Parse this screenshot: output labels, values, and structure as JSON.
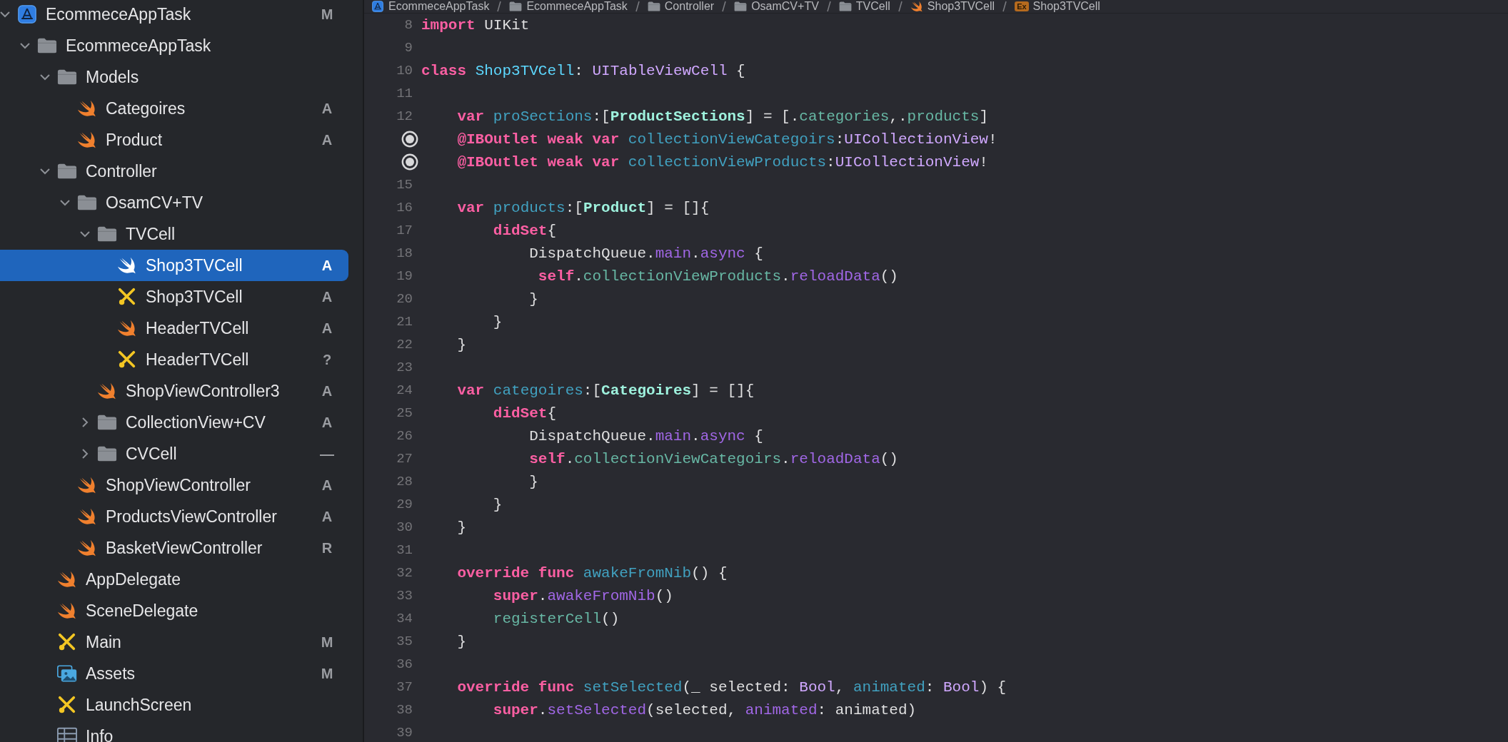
{
  "navigator": {
    "items": [
      {
        "label": "EcommeceAppTask",
        "kind": "project",
        "status": "M",
        "selected": false,
        "expanded": true,
        "children": [
          {
            "label": "EcommeceAppTask",
            "kind": "folder",
            "selected": false,
            "expanded": true,
            "children": [
              {
                "label": "Models",
                "kind": "folder",
                "selected": false,
                "expanded": true,
                "children": [
                  {
                    "label": "Categoires",
                    "kind": "swift",
                    "status": "A",
                    "selected": false
                  },
                  {
                    "label": "Product",
                    "kind": "swift",
                    "status": "A",
                    "selected": false
                  }
                ]
              },
              {
                "label": "Controller",
                "kind": "folder",
                "selected": false,
                "expanded": true,
                "children": [
                  {
                    "label": "OsamCV+TV",
                    "kind": "folder",
                    "selected": false,
                    "expanded": true,
                    "children": [
                      {
                        "label": "TVCell",
                        "kind": "folder",
                        "selected": false,
                        "expanded": true,
                        "children": [
                          {
                            "label": "Shop3TVCell",
                            "kind": "swift",
                            "status": "A",
                            "selected": true
                          },
                          {
                            "label": "Shop3TVCell",
                            "kind": "xib",
                            "status": "A",
                            "selected": false
                          },
                          {
                            "label": "HeaderTVCell",
                            "kind": "swift",
                            "status": "A",
                            "selected": false
                          },
                          {
                            "label": "HeaderTVCell",
                            "kind": "xib",
                            "status": "?",
                            "selected": false
                          }
                        ]
                      },
                      {
                        "label": "ShopViewController3",
                        "kind": "swift",
                        "status": "A",
                        "selected": false
                      },
                      {
                        "label": "CollectionView+CV",
                        "kind": "folder",
                        "status": "A",
                        "selected": false,
                        "expanded": false
                      },
                      {
                        "label": "CVCell",
                        "kind": "folder",
                        "status": "—",
                        "selected": false,
                        "expanded": false
                      }
                    ]
                  },
                  {
                    "label": "ShopViewController",
                    "kind": "swift",
                    "status": "A",
                    "selected": false
                  },
                  {
                    "label": "ProductsViewController",
                    "kind": "swift",
                    "status": "A",
                    "selected": false
                  },
                  {
                    "label": "BasketViewController",
                    "kind": "swift",
                    "status": "R",
                    "selected": false
                  }
                ]
              },
              {
                "label": "AppDelegate",
                "kind": "swift",
                "selected": false
              },
              {
                "label": "SceneDelegate",
                "kind": "swift",
                "selected": false
              },
              {
                "label": "Main",
                "kind": "xib",
                "status": "M",
                "selected": false
              },
              {
                "label": "Assets",
                "kind": "assets",
                "status": "M",
                "selected": false
              },
              {
                "label": "LaunchScreen",
                "kind": "xib",
                "selected": false
              },
              {
                "label": "Info",
                "kind": "plist",
                "selected": false
              }
            ]
          }
        ]
      }
    ]
  },
  "breadcrumb": [
    {
      "label": "EcommeceAppTask",
      "kind": "project"
    },
    {
      "label": "EcommeceAppTask",
      "kind": "folder"
    },
    {
      "label": "Controller",
      "kind": "folder"
    },
    {
      "label": "OsamCV+TV",
      "kind": "folder"
    },
    {
      "label": "TVCell",
      "kind": "folder"
    },
    {
      "label": "Shop3TVCell",
      "kind": "swift"
    },
    {
      "label": "Shop3TVCell",
      "kind": "badge",
      "badge": "Ex"
    }
  ],
  "editor": {
    "lines": [
      {
        "number": "8",
        "tokens": [
          {
            "kind": "kw",
            "text": "import"
          },
          {
            "kind": "plain",
            "text": " UIKit"
          }
        ]
      },
      {
        "number": "9"
      },
      {
        "number": "10",
        "tokens": [
          {
            "kind": "kw",
            "text": "class "
          },
          {
            "kind": "dtype",
            "text": "Shop3TVCell"
          },
          {
            "kind": "plain",
            "text": ": "
          },
          {
            "kind": "stype",
            "text": "UITableViewCell"
          },
          {
            "kind": "plain",
            "text": " {"
          }
        ]
      },
      {
        "number": "11"
      },
      {
        "number": "12",
        "tokens": [
          {
            "kind": "kw",
            "text": "    var "
          },
          {
            "kind": "decl",
            "text": "proSections"
          },
          {
            "kind": "plain",
            "text": ":["
          },
          {
            "kind": "ptype",
            "text": "ProductSections"
          },
          {
            "kind": "plain",
            "text": "] = [."
          },
          {
            "kind": "proj",
            "text": "categories"
          },
          {
            "kind": "plain",
            "text": ",."
          },
          {
            "kind": "proj",
            "text": "products"
          },
          {
            "kind": "plain",
            "text": "]"
          }
        ]
      },
      {
        "outlet": true,
        "tokens": [
          {
            "kind": "kw",
            "text": "    @IBOutlet weak var "
          },
          {
            "kind": "decl",
            "text": "collectionViewCategoirs"
          },
          {
            "kind": "plain",
            "text": ":"
          },
          {
            "kind": "stype",
            "text": "UICollectionView"
          },
          {
            "kind": "plain",
            "text": "!"
          }
        ]
      },
      {
        "outlet": true,
        "tokens": [
          {
            "kind": "kw",
            "text": "    @IBOutlet weak var "
          },
          {
            "kind": "decl",
            "text": "collectionViewProducts"
          },
          {
            "kind": "plain",
            "text": ":"
          },
          {
            "kind": "stype",
            "text": "UICollectionView"
          },
          {
            "kind": "plain",
            "text": "!"
          }
        ]
      },
      {
        "number": "15"
      },
      {
        "number": "16",
        "tokens": [
          {
            "kind": "kw",
            "text": "    var "
          },
          {
            "kind": "decl",
            "text": "products"
          },
          {
            "kind": "plain",
            "text": ":["
          },
          {
            "kind": "ptype",
            "text": "Product"
          },
          {
            "kind": "plain",
            "text": "] = []{"
          }
        ]
      },
      {
        "number": "17",
        "tokens": [
          {
            "kind": "kw",
            "text": "        didSet"
          },
          {
            "kind": "plain",
            "text": "{"
          }
        ]
      },
      {
        "number": "18",
        "tokens": [
          {
            "kind": "plain",
            "text": "            DispatchQueue."
          },
          {
            "kind": "sys",
            "text": "main"
          },
          {
            "kind": "plain",
            "text": "."
          },
          {
            "kind": "sys",
            "text": "async"
          },
          {
            "kind": "plain",
            "text": " {"
          }
        ]
      },
      {
        "number": "19",
        "tokens": [
          {
            "kind": "kw",
            "text": "             self"
          },
          {
            "kind": "plain",
            "text": "."
          },
          {
            "kind": "proj",
            "text": "collectionViewProducts"
          },
          {
            "kind": "plain",
            "text": "."
          },
          {
            "kind": "sys",
            "text": "reloadData"
          },
          {
            "kind": "plain",
            "text": "()"
          }
        ]
      },
      {
        "number": "20",
        "tokens": [
          {
            "kind": "plain",
            "text": "            }"
          }
        ]
      },
      {
        "number": "21",
        "tokens": [
          {
            "kind": "plain",
            "text": "        }"
          }
        ]
      },
      {
        "number": "22",
        "tokens": [
          {
            "kind": "plain",
            "text": "    }"
          }
        ]
      },
      {
        "number": "23"
      },
      {
        "number": "24",
        "tokens": [
          {
            "kind": "kw",
            "text": "    var "
          },
          {
            "kind": "decl",
            "text": "categoires"
          },
          {
            "kind": "plain",
            "text": ":["
          },
          {
            "kind": "ptype",
            "text": "Categoires"
          },
          {
            "kind": "plain",
            "text": "] = []{"
          }
        ]
      },
      {
        "number": "25",
        "tokens": [
          {
            "kind": "kw",
            "text": "        didSet"
          },
          {
            "kind": "plain",
            "text": "{"
          }
        ]
      },
      {
        "number": "26",
        "tokens": [
          {
            "kind": "plain",
            "text": "            DispatchQueue."
          },
          {
            "kind": "sys",
            "text": "main"
          },
          {
            "kind": "plain",
            "text": "."
          },
          {
            "kind": "sys",
            "text": "async"
          },
          {
            "kind": "plain",
            "text": " {"
          }
        ]
      },
      {
        "number": "27",
        "tokens": [
          {
            "kind": "kw",
            "text": "            self"
          },
          {
            "kind": "plain",
            "text": "."
          },
          {
            "kind": "proj",
            "text": "collectionViewCategoirs"
          },
          {
            "kind": "plain",
            "text": "."
          },
          {
            "kind": "sys",
            "text": "reloadData"
          },
          {
            "kind": "plain",
            "text": "()"
          }
        ]
      },
      {
        "number": "28",
        "tokens": [
          {
            "kind": "plain",
            "text": "            }"
          }
        ]
      },
      {
        "number": "29",
        "tokens": [
          {
            "kind": "plain",
            "text": "        }"
          }
        ]
      },
      {
        "number": "30",
        "tokens": [
          {
            "kind": "plain",
            "text": "    }"
          }
        ]
      },
      {
        "number": "31"
      },
      {
        "number": "32",
        "tokens": [
          {
            "kind": "kw",
            "text": "    override func "
          },
          {
            "kind": "decl",
            "text": "awakeFromNib"
          },
          {
            "kind": "plain",
            "text": "() {"
          }
        ]
      },
      {
        "number": "33",
        "tokens": [
          {
            "kind": "kw",
            "text": "        super"
          },
          {
            "kind": "plain",
            "text": "."
          },
          {
            "kind": "sys",
            "text": "awakeFromNib"
          },
          {
            "kind": "plain",
            "text": "()"
          }
        ]
      },
      {
        "number": "34",
        "tokens": [
          {
            "kind": "proj",
            "text": "        registerCell"
          },
          {
            "kind": "plain",
            "text": "()"
          }
        ]
      },
      {
        "number": "35",
        "tokens": [
          {
            "kind": "plain",
            "text": "    }"
          }
        ]
      },
      {
        "number": "36"
      },
      {
        "number": "37",
        "tokens": [
          {
            "kind": "kw",
            "text": "    override func "
          },
          {
            "kind": "decl",
            "text": "setSelected"
          },
          {
            "kind": "plain",
            "text": "(_ selected: "
          },
          {
            "kind": "stype",
            "text": "Bool"
          },
          {
            "kind": "plain",
            "text": ", "
          },
          {
            "kind": "decl",
            "text": "animated"
          },
          {
            "kind": "plain",
            "text": ": "
          },
          {
            "kind": "stype",
            "text": "Bool"
          },
          {
            "kind": "plain",
            "text": ") {"
          }
        ]
      },
      {
        "number": "38",
        "tokens": [
          {
            "kind": "kw",
            "text": "        super"
          },
          {
            "kind": "plain",
            "text": "."
          },
          {
            "kind": "sys",
            "text": "setSelected"
          },
          {
            "kind": "plain",
            "text": "(selected, "
          },
          {
            "kind": "sys",
            "text": "animated"
          },
          {
            "kind": "plain",
            "text": ": animated)"
          }
        ]
      },
      {
        "number": "39"
      }
    ]
  }
}
